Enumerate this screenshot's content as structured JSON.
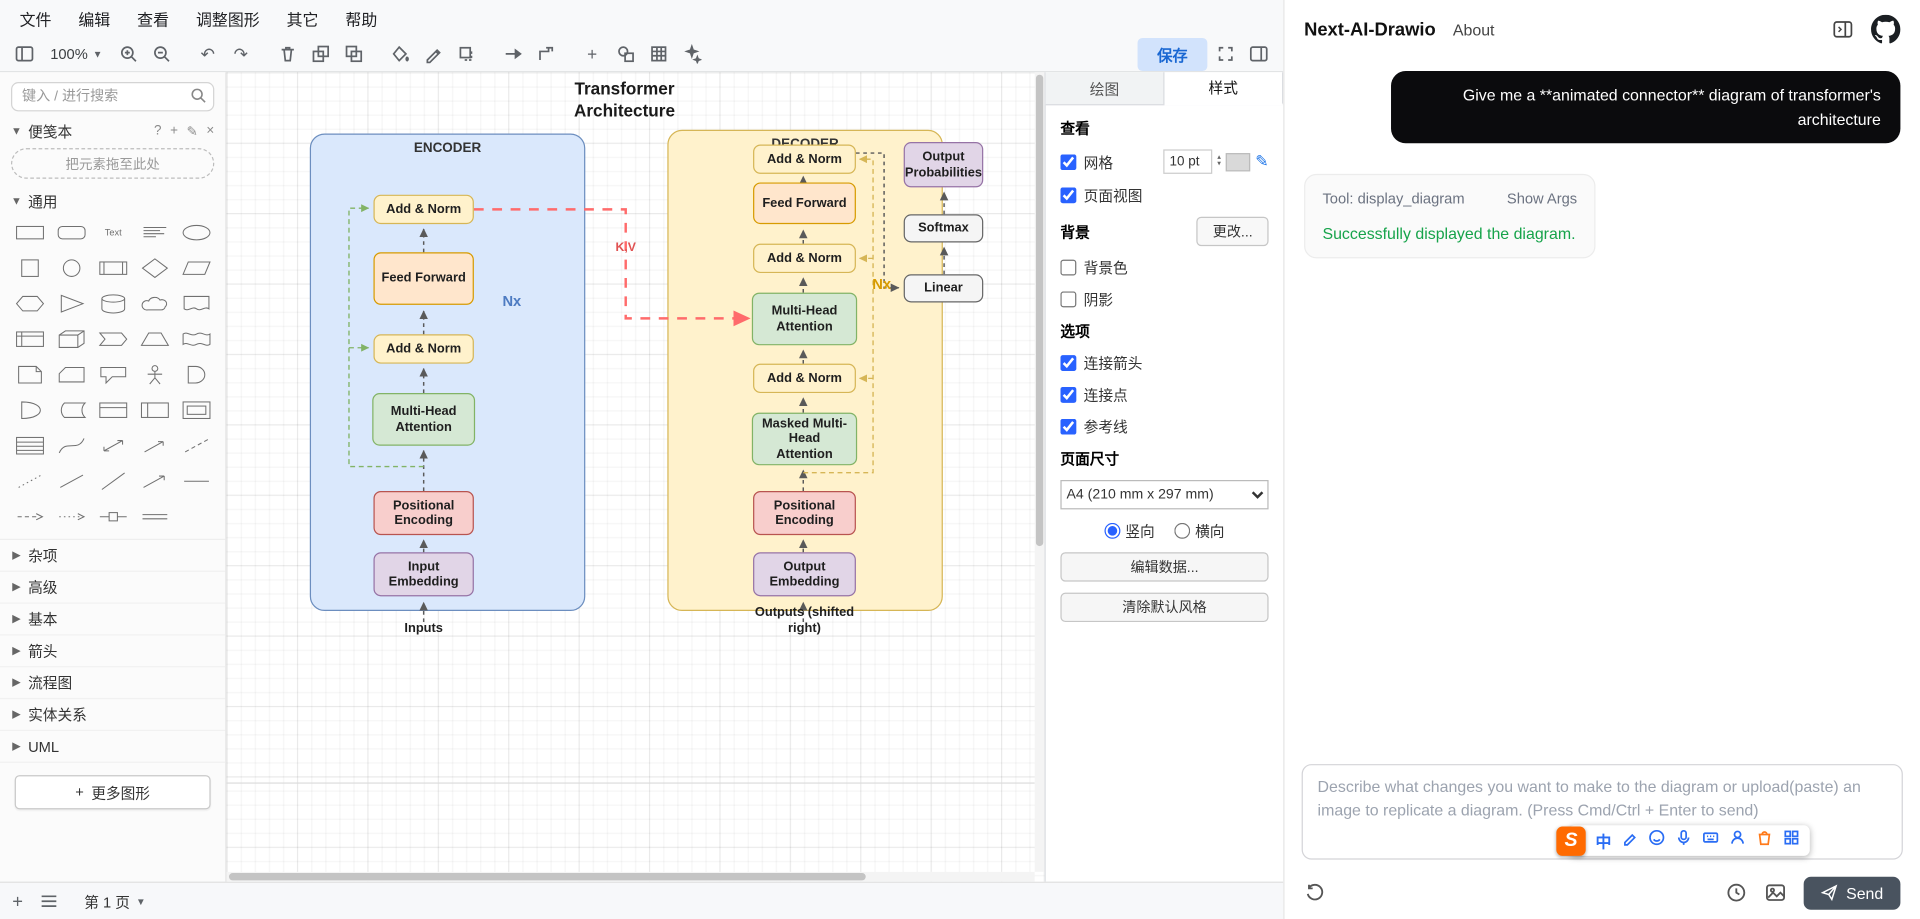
{
  "menubar": {
    "items": [
      "文件",
      "编辑",
      "查看",
      "调整图形",
      "其它",
      "帮助"
    ]
  },
  "toolbar": {
    "zoom": "100%",
    "save_label": "保存"
  },
  "sidebar": {
    "search_placeholder": "键入 / 进行搜索",
    "scratchpad_label": "便笺本",
    "scratchpad_drop": "把元素拖至此处",
    "general_label": "通用",
    "sections": [
      "杂项",
      "高级",
      "基本",
      "箭头",
      "流程图",
      "实体关系",
      "UML"
    ],
    "more_shapes_label": "更多图形"
  },
  "diagram": {
    "title": "Transformer Architecture",
    "encoder_label": "ENCODER",
    "decoder_label": "DECODER",
    "encoder_blocks": [
      "Add & Norm",
      "Feed Forward",
      "Add & Norm",
      "Multi-Head Attention",
      "Positional Encoding",
      "Input Embedding"
    ],
    "decoder_blocks": [
      "Add & Norm",
      "Feed Forward",
      "Add & Norm",
      "Multi-Head Attention",
      "Add & Norm",
      "Masked Multi-Head Attention",
      "Positional Encoding",
      "Output Embedding"
    ],
    "output_blocks": [
      "Output Probabilities",
      "Softmax",
      "Linear"
    ],
    "inputs_label": "Inputs",
    "outputs_label": "Outputs (shifted right)",
    "nx_encoder": "Nx",
    "nx_decoder": "Nx",
    "kv_label": "K,V",
    "colors": {
      "encoder_fill": "#dae8fc",
      "encoder_stroke": "#6c8ebf",
      "decoder_fill": "#fff2cc",
      "decoder_stroke": "#d6b656",
      "yellow_fill": "#fff2cc",
      "orange_fill": "#ffe6cc",
      "green_fill": "#d5e8d4",
      "pink_fill": "#f8cecc",
      "purple_fill": "#e1d5e7",
      "gray_fill": "#f5f5f5",
      "animated_connector": "#ff6b6b"
    }
  },
  "format_panel": {
    "tabs": [
      "绘图",
      "样式"
    ],
    "view_label": "查看",
    "grid_label": "网格",
    "grid_size": "10 pt",
    "page_view_label": "页面视图",
    "background_label": "背景",
    "change_label": "更改...",
    "bg_color_label": "背景色",
    "shadow_label": "阴影",
    "options_label": "选项",
    "option_items": [
      "连接箭头",
      "连接点",
      "参考线"
    ],
    "page_size_label": "页面尺寸",
    "page_size_value": "A4 (210 mm x 297 mm)",
    "portrait_label": "竖向",
    "landscape_label": "横向",
    "edit_data_label": "编辑数据...",
    "clear_style_label": "清除默认风格"
  },
  "footer": {
    "page_label": "第 1 页"
  },
  "chat": {
    "title": "Next-AI-Drawio",
    "about": "About",
    "user_message": "Give me a **animated connector** diagram of transformer's architecture",
    "tool_name": "Tool: display_diagram",
    "show_args": "Show Args",
    "tool_result": "Successfully displayed the diagram.",
    "input_placeholder": "Describe what changes you want to make to the diagram or upload(paste) an image to replicate a diagram. (Press Cmd/Ctrl + Enter to send)",
    "send_label": "Send",
    "ime_char": "中"
  }
}
